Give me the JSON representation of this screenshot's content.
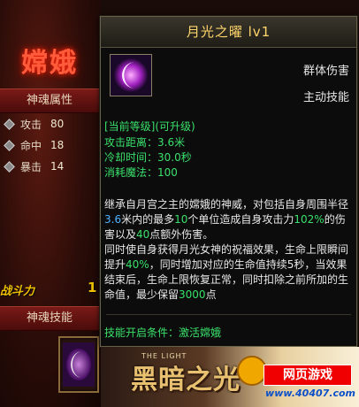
{
  "character": {
    "name": "嫦娥",
    "attributes_header": "神魂属性",
    "attributes": [
      {
        "label": "攻击",
        "value": "80"
      },
      {
        "label": "命中",
        "value": "18"
      },
      {
        "label": "暴击",
        "value": "14"
      }
    ],
    "combat_label": "战斗力",
    "combat_value": "1",
    "skills_header": "神魂技能"
  },
  "tooltip": {
    "title": "月光之曜 lv1",
    "skill_type": "群体伤害",
    "skill_mode": "主动技能",
    "level_tag": "[当前等级](可升级)",
    "stats": [
      {
        "label": "攻击距离：",
        "value": "3.6米"
      },
      {
        "label": "冷却时间：",
        "value": "30.0秒"
      },
      {
        "label": "消耗魔法：",
        "value": "100"
      }
    ],
    "desc": {
      "p1a": "继承自月宫之主的嫦娥的神威，对包括自身周围半径",
      "p1_radius": "3.6",
      "p1b": "米内的最多",
      "p1_count": "10",
      "p1c": "个单位造成自身攻击力",
      "p1_pct": "102%",
      "p1d": "的伤害以及",
      "p1_extra": "40",
      "p1e": "点额外伤害。",
      "p2a": "同时使自身获得月光女神的祝福效果，生命上限瞬间提升",
      "p2_pct": "40%",
      "p2b": "，同时增加对应的生命值持续5秒，当效果结束后，生命上限恢复正常，同时扣除之前所加的生命值，最少保留",
      "p2_min": "3000",
      "p2c": "点"
    },
    "condition": "技能开启条件：激活嫦娥"
  },
  "banner": {
    "small_text": "THE LIGHT",
    "logo_text": "黑暗之光",
    "site_name": "网页游戏",
    "site_url": "www.40407.com"
  },
  "colors": {
    "title_gold": "#ffd66a",
    "highlight_green": "#3ae06a",
    "highlight_blue": "#4fb2ff",
    "section_red": "#7a1a18"
  },
  "icons": {
    "skill": "crescent-moon-icon",
    "attr_bullet": "diamond-bullet-icon"
  }
}
